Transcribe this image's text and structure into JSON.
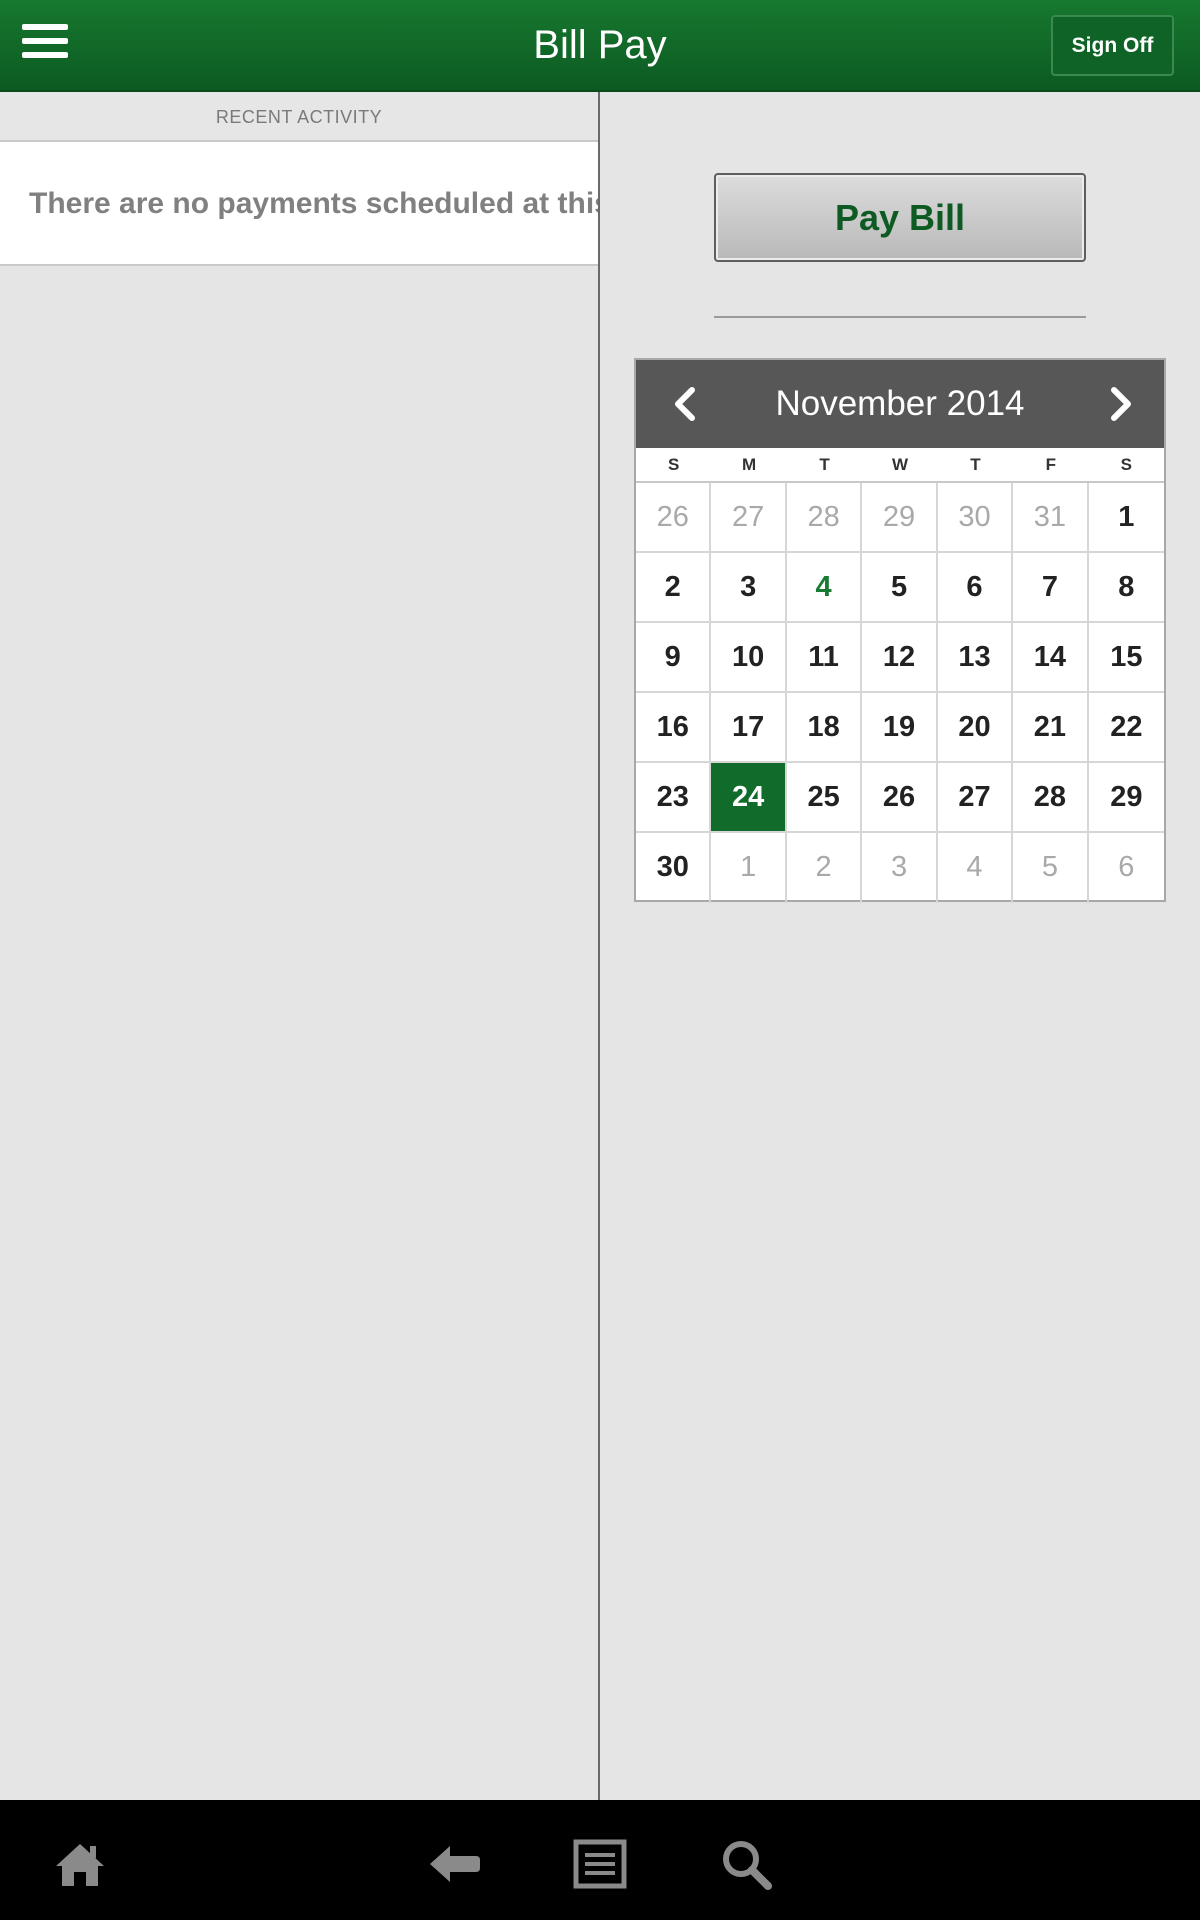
{
  "header": {
    "title": "Bill Pay",
    "menu_icon": "hamburger-menu-icon",
    "sign_off_label": "Sign Off"
  },
  "left": {
    "recent_activity_label": "RECENT ACTIVITY",
    "empty_message": "There are no payments scheduled at this"
  },
  "right": {
    "pay_bill_label": "Pay Bill"
  },
  "calendar": {
    "title": "November 2014",
    "prev_icon": "chevron-left-icon",
    "next_icon": "chevron-right-icon",
    "weekdays": [
      "S",
      "M",
      "T",
      "W",
      "T",
      "F",
      "S"
    ],
    "weeks": [
      [
        {
          "d": "26",
          "other": true
        },
        {
          "d": "27",
          "other": true
        },
        {
          "d": "28",
          "other": true
        },
        {
          "d": "29",
          "other": true
        },
        {
          "d": "30",
          "other": true
        },
        {
          "d": "31",
          "other": true
        },
        {
          "d": "1"
        }
      ],
      [
        {
          "d": "2"
        },
        {
          "d": "3"
        },
        {
          "d": "4",
          "today": true
        },
        {
          "d": "5"
        },
        {
          "d": "6"
        },
        {
          "d": "7"
        },
        {
          "d": "8"
        }
      ],
      [
        {
          "d": "9"
        },
        {
          "d": "10"
        },
        {
          "d": "11"
        },
        {
          "d": "12"
        },
        {
          "d": "13"
        },
        {
          "d": "14"
        },
        {
          "d": "15"
        }
      ],
      [
        {
          "d": "16"
        },
        {
          "d": "17"
        },
        {
          "d": "18"
        },
        {
          "d": "19"
        },
        {
          "d": "20"
        },
        {
          "d": "21"
        },
        {
          "d": "22"
        }
      ],
      [
        {
          "d": "23"
        },
        {
          "d": "24",
          "selected": true
        },
        {
          "d": "25"
        },
        {
          "d": "26"
        },
        {
          "d": "27"
        },
        {
          "d": "28"
        },
        {
          "d": "29"
        }
      ],
      [
        {
          "d": "30"
        },
        {
          "d": "1",
          "other": true
        },
        {
          "d": "2",
          "other": true
        },
        {
          "d": "3",
          "other": true
        },
        {
          "d": "4",
          "other": true
        },
        {
          "d": "5",
          "other": true
        },
        {
          "d": "6",
          "other": true
        }
      ]
    ]
  },
  "bottom_nav": [
    "home-icon",
    "back-icon",
    "recent-apps-icon",
    "search-icon"
  ],
  "colors": {
    "brand_green": "#116b2a",
    "header_green": "#17782f",
    "today_green": "#197a33",
    "calendar_header": "#575757"
  }
}
